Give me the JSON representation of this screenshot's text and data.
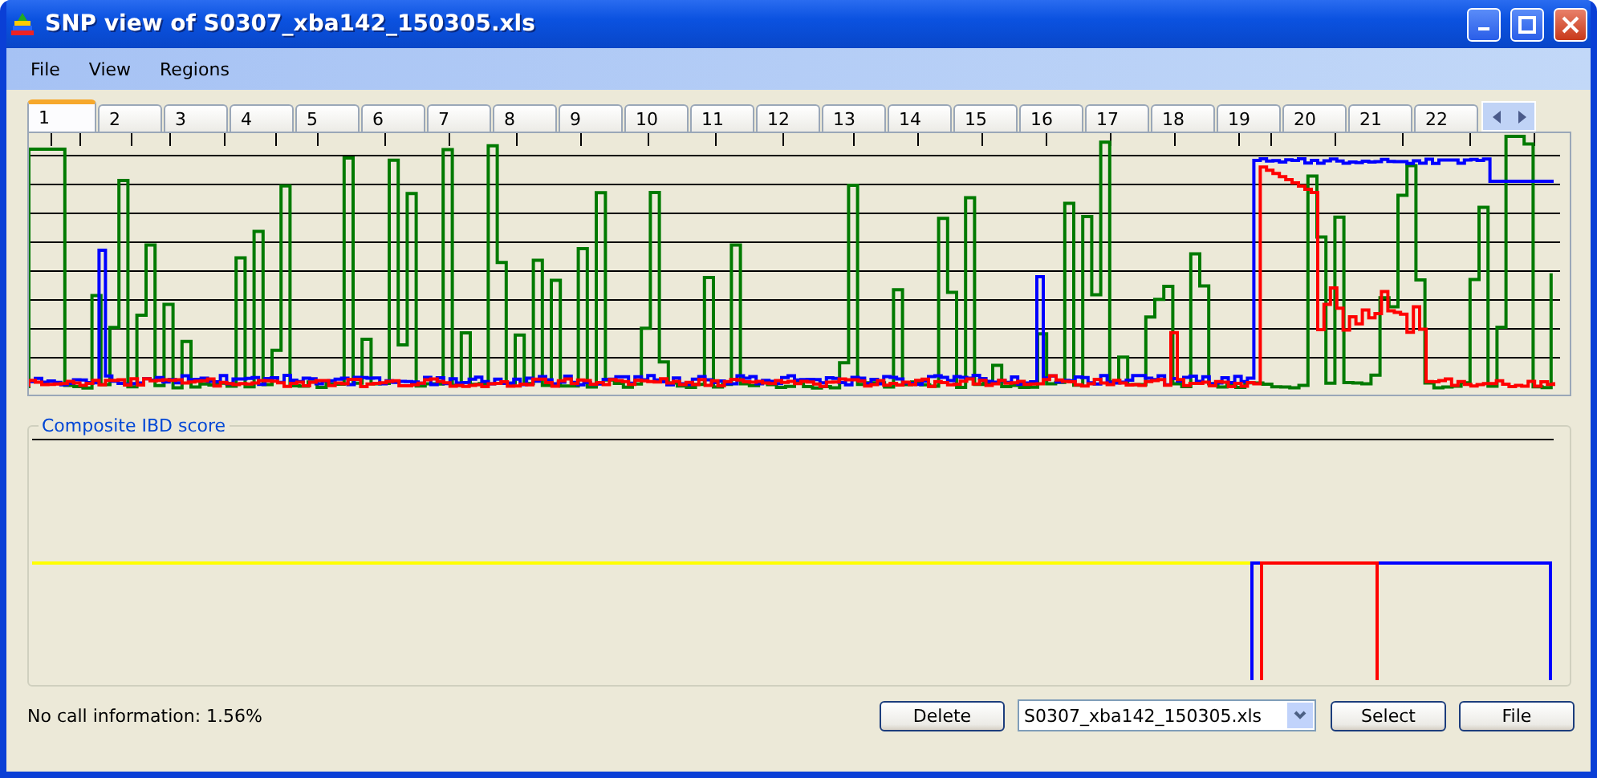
{
  "window": {
    "title": "SNP view of S0307_xba142_150305.xls"
  },
  "menu": [
    "File",
    "View",
    "Regions"
  ],
  "tabs": [
    {
      "label": "1",
      "selected": true
    },
    {
      "label": "2",
      "selected": false
    },
    {
      "label": "3",
      "selected": false
    },
    {
      "label": "4",
      "selected": false
    },
    {
      "label": "5",
      "selected": false
    },
    {
      "label": "6",
      "selected": false
    },
    {
      "label": "7",
      "selected": false
    },
    {
      "label": "8",
      "selected": false
    },
    {
      "label": "9",
      "selected": false
    },
    {
      "label": "10",
      "selected": false
    },
    {
      "label": "11",
      "selected": false
    },
    {
      "label": "12",
      "selected": false
    },
    {
      "label": "13",
      "selected": false
    },
    {
      "label": "14",
      "selected": false
    },
    {
      "label": "15",
      "selected": false
    },
    {
      "label": "16",
      "selected": false
    },
    {
      "label": "17",
      "selected": false
    },
    {
      "label": "18",
      "selected": false
    },
    {
      "label": "19",
      "selected": false
    },
    {
      "label": "20",
      "selected": false
    },
    {
      "label": "21",
      "selected": false
    },
    {
      "label": "22",
      "selected": false
    }
  ],
  "composite": {
    "title": "Composite IBD score"
  },
  "status": "No call information: 1.56%",
  "buttons": {
    "delete": "Delete",
    "select": "Select",
    "file": "File"
  },
  "file_select": {
    "value": "S0307_xba142_150305.xls"
  }
}
